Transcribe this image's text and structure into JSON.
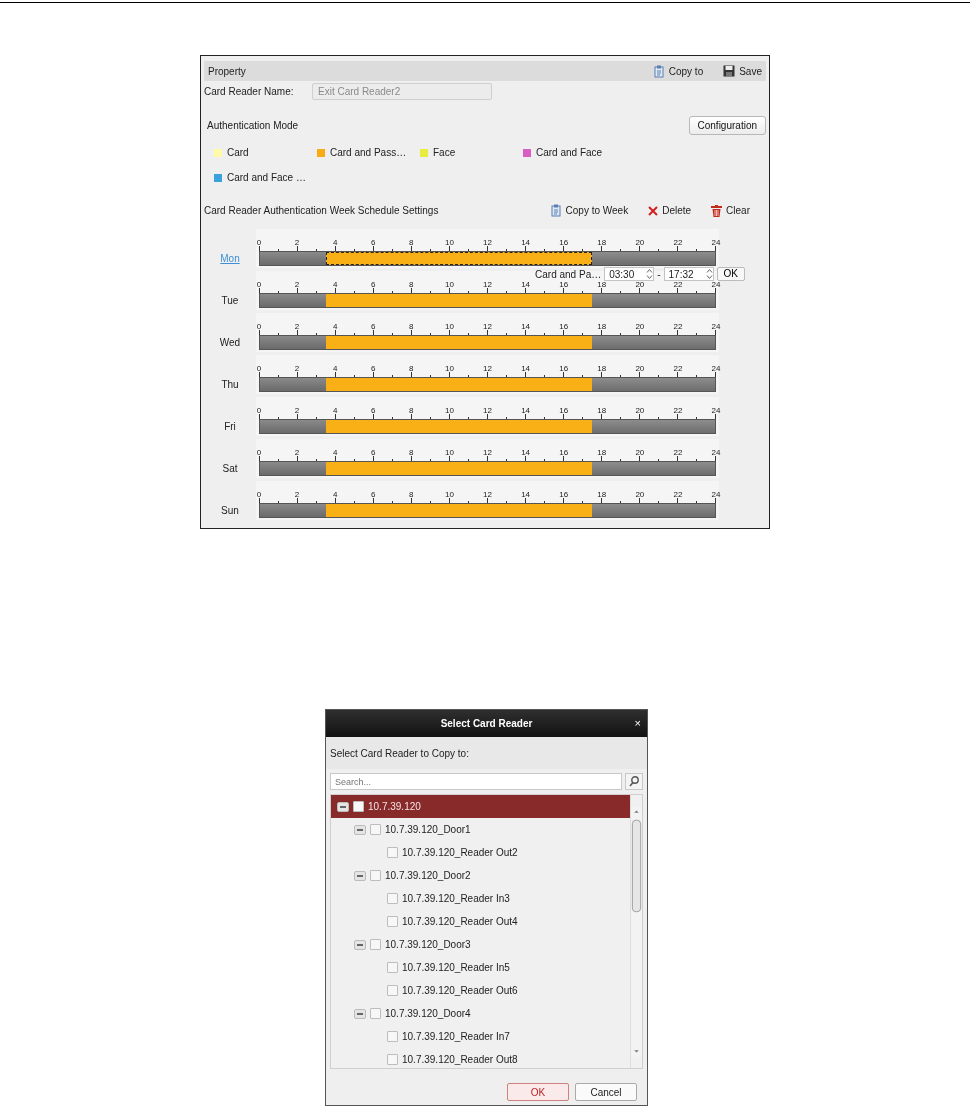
{
  "property_panel": {
    "title": "Property",
    "toolbar": [
      {
        "label": "Copy to",
        "kind": "copy"
      },
      {
        "label": "Save",
        "kind": "save"
      }
    ],
    "card_reader_name": {
      "label": "Card Reader Name:",
      "value": "Exit Card Reader2",
      "disabled": true
    },
    "authentication_mode": {
      "label": "Authentication Mode",
      "button": "Configuration",
      "modes": [
        {
          "label": "Card",
          "color": "#fffaa8"
        },
        {
          "label": "Card and Pass…",
          "color": "#f9ab16"
        },
        {
          "label": "Face",
          "color": "#e8ec3c"
        },
        {
          "label": "Card and Face",
          "color": "#d95ec4"
        },
        {
          "label": "Card and Face …",
          "color": "#3aa3df"
        }
      ]
    },
    "schedule": {
      "title": "Card Reader Authentication Week Schedule Settings",
      "actions": [
        {
          "label": "Copy to Week",
          "kind": "copy"
        },
        {
          "label": "Delete",
          "kind": "delete"
        },
        {
          "label": "Clear",
          "kind": "clear"
        }
      ],
      "days": [
        {
          "label": "Mon",
          "selected": true,
          "axis_labels": [
            "0",
            "2",
            "4",
            "6",
            "8",
            "10",
            "12",
            "14",
            "16",
            "18",
            "20",
            "22",
            "24"
          ],
          "blocks": [
            {
              "kind": "empty",
              "level": 0.1458
            },
            {
              "kind": "mode",
              "color": "#f9b016",
              "selected": true,
              "level": 0.6845
            }
          ]
        },
        {
          "label": "Tue",
          "selected": false,
          "axis_labels": [
            "0",
            "2",
            "4",
            "6",
            "8",
            "10",
            "12",
            "14",
            "16",
            "18",
            "20",
            "22",
            "24"
          ],
          "blocks": [
            {
              "kind": "empty",
              "level": 0.1458
            },
            {
              "kind": "mode",
              "color": "#f9b016",
              "selected": false,
              "level": 0.6845
            }
          ]
        },
        {
          "label": "Wed",
          "selected": false,
          "axis_labels": [
            "0",
            "2",
            "4",
            "6",
            "8",
            "10",
            "12",
            "14",
            "16",
            "18",
            "20",
            "22",
            "24"
          ],
          "blocks": [
            {
              "kind": "empty",
              "level": 0.1458
            },
            {
              "kind": "mode",
              "color": "#f9b016",
              "selected": false,
              "level": 0.6845
            }
          ]
        },
        {
          "label": "Thu",
          "selected": false,
          "axis_labels": [
            "0",
            "2",
            "4",
            "6",
            "8",
            "10",
            "12",
            "14",
            "16",
            "18",
            "20",
            "22",
            "24"
          ],
          "blocks": [
            {
              "kind": "empty",
              "level": 0.1458
            },
            {
              "kind": "mode",
              "color": "#f9b016",
              "selected": false,
              "level": 0.6845
            }
          ]
        },
        {
          "label": "Fri",
          "selected": false,
          "axis_labels": [
            "0",
            "2",
            "4",
            "6",
            "8",
            "10",
            "12",
            "14",
            "16",
            "18",
            "20",
            "22",
            "24"
          ],
          "blocks": [
            {
              "kind": "empty",
              "level": 0.1458
            },
            {
              "kind": "mode",
              "color": "#f9b016",
              "selected": false,
              "level": 0.6845
            }
          ]
        },
        {
          "label": "Sat",
          "selected": false,
          "axis_labels": [
            "0",
            "2",
            "4",
            "6",
            "8",
            "10",
            "12",
            "14",
            "16",
            "18",
            "20",
            "22",
            "24"
          ],
          "blocks": [
            {
              "kind": "empty",
              "level": 0.1458
            },
            {
              "kind": "mode",
              "color": "#f9b016",
              "selected": false,
              "level": 0.6845
            }
          ]
        },
        {
          "label": "Sun",
          "selected": false,
          "axis_labels": [
            "0",
            "2",
            "4",
            "6",
            "8",
            "10",
            "12",
            "14",
            "16",
            "18",
            "20",
            "22",
            "24"
          ],
          "blocks": [
            {
              "kind": "empty",
              "level": 0.1458
            },
            {
              "kind": "mode",
              "color": "#f9b016",
              "selected": false,
              "level": 0.6845
            }
          ]
        }
      ],
      "editor": {
        "mode": "Card and Pa…",
        "start": "03:30",
        "separator": "-",
        "end": "17:32",
        "button": "OK"
      }
    }
  },
  "dialog": {
    "title": "Select Card Reader",
    "close": "×",
    "prompt": "Select Card Reader to Copy to:",
    "search": {
      "placeholder": "Search..."
    },
    "tree": [
      {
        "label": "10.7.39.120",
        "selected": true,
        "checked": false,
        "expanded": true,
        "children": [
          {
            "label": "10.7.39.120_Door1",
            "selected": false,
            "checked": false,
            "expanded": true,
            "children": [
              {
                "label": "10.7.39.120_Reader Out2",
                "selected": false,
                "checked": false
              }
            ]
          },
          {
            "label": "10.7.39.120_Door2",
            "selected": false,
            "checked": false,
            "expanded": true,
            "children": [
              {
                "label": "10.7.39.120_Reader In3",
                "selected": false,
                "checked": false
              },
              {
                "label": "10.7.39.120_Reader Out4",
                "selected": false,
                "checked": false
              }
            ]
          },
          {
            "label": "10.7.39.120_Door3",
            "selected": false,
            "checked": false,
            "expanded": true,
            "children": [
              {
                "label": "10.7.39.120_Reader In5",
                "selected": false,
                "checked": false
              },
              {
                "label": "10.7.39.120_Reader Out6",
                "selected": false,
                "checked": false
              }
            ]
          },
          {
            "label": "10.7.39.120_Door4",
            "selected": false,
            "checked": false,
            "expanded": true,
            "children": [
              {
                "label": "10.7.39.120_Reader In7",
                "selected": false,
                "checked": false
              },
              {
                "label": "10.7.39.120_Reader Out8",
                "selected": false,
                "checked": false
              }
            ]
          }
        ]
      }
    ],
    "buttons": [
      {
        "label": "OK",
        "kind": "primary"
      },
      {
        "label": "Cancel",
        "kind": "secondary"
      }
    ]
  }
}
